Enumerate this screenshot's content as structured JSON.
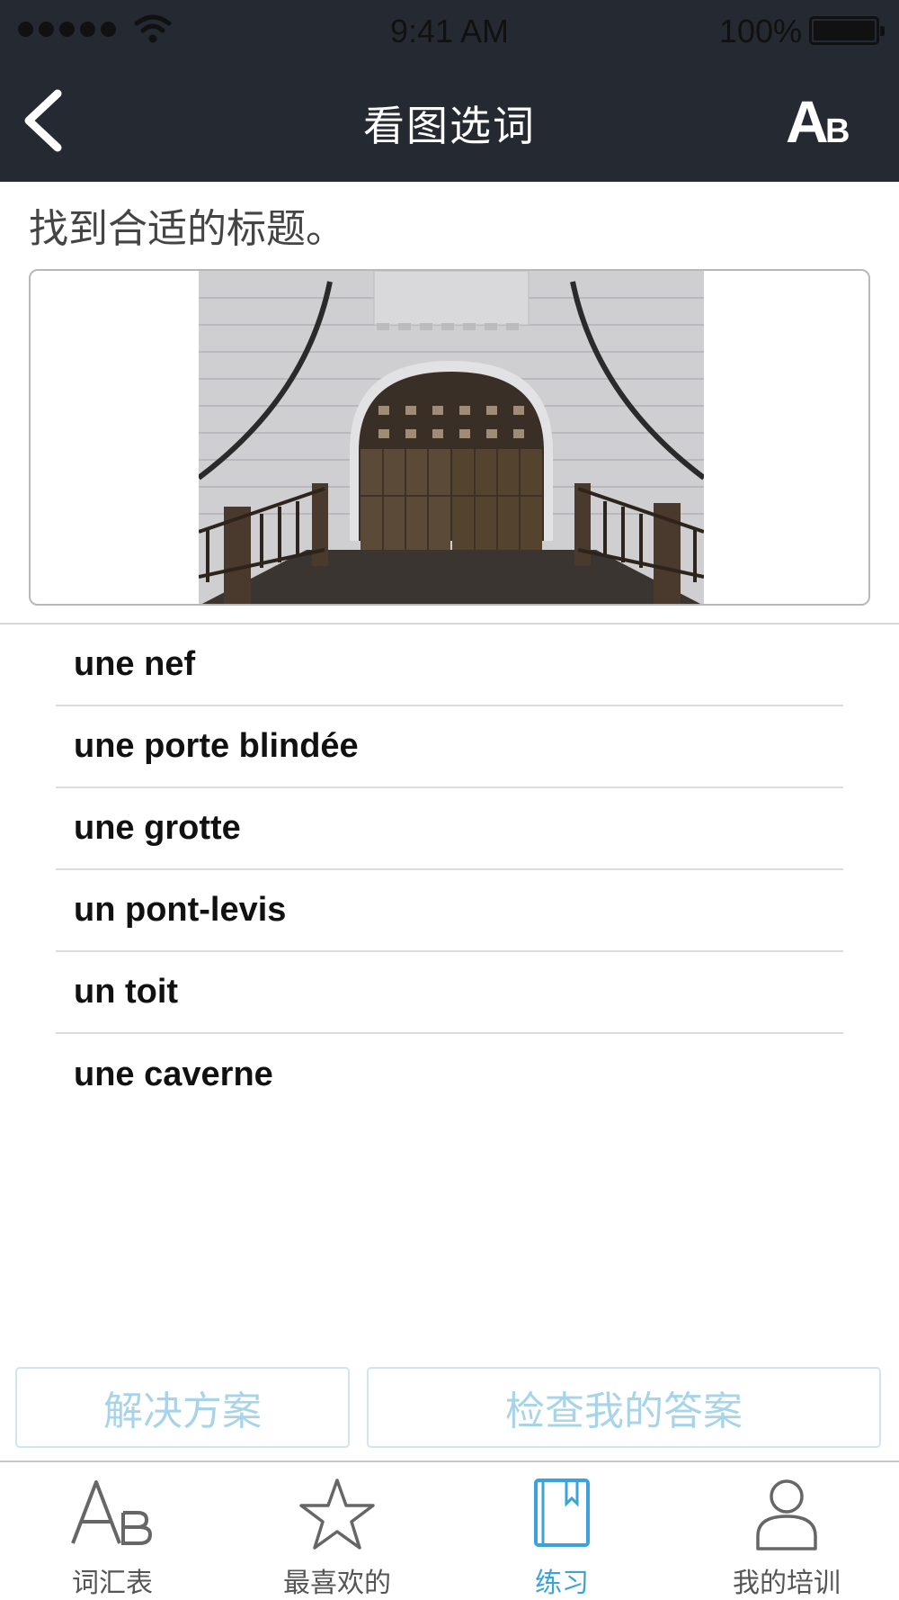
{
  "status_bar": {
    "time": "9:41 AM",
    "battery": "100%"
  },
  "nav": {
    "title": "看图选词",
    "back_icon": "chevron-left-icon",
    "font_icon": "ab-text-icon"
  },
  "prompt": "找到合适的标题。",
  "options": [
    "une nef",
    "une porte blindée",
    "une grotte",
    "un pont-levis",
    "un toit",
    "une caverne"
  ],
  "actions": {
    "solution": "解决方案",
    "check": "检查我的答案"
  },
  "tabs": [
    {
      "label": "词汇表",
      "icon": "ab-vocabulary-icon",
      "active": false
    },
    {
      "label": "最喜欢的",
      "icon": "star-icon",
      "active": false
    },
    {
      "label": "练习",
      "icon": "book-icon",
      "active": true
    },
    {
      "label": "我的培训",
      "icon": "person-icon",
      "active": false
    }
  ],
  "colors": {
    "nav_background": "#252932",
    "accent": "#3aa3dc",
    "button_text": "#a8d4ea",
    "button_border": "#cfe6f2"
  }
}
